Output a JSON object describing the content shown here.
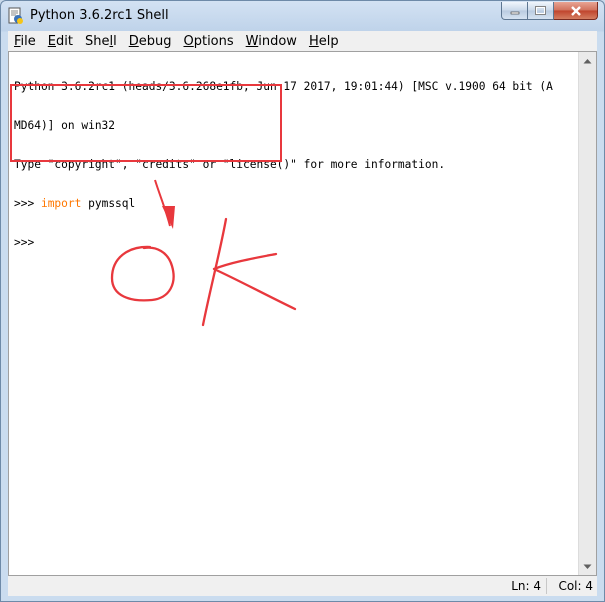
{
  "window": {
    "title": "Python 3.6.2rc1 Shell"
  },
  "menu": [
    {
      "pre": "",
      "u": "F",
      "post": "ile"
    },
    {
      "pre": "",
      "u": "E",
      "post": "dit"
    },
    {
      "pre": "She",
      "u": "l",
      "post": "l"
    },
    {
      "pre": "",
      "u": "D",
      "post": "ebug"
    },
    {
      "pre": "",
      "u": "O",
      "post": "ptions"
    },
    {
      "pre": "",
      "u": "W",
      "post": "indow"
    },
    {
      "pre": "",
      "u": "H",
      "post": "elp"
    }
  ],
  "shell": {
    "line1": "Python 3.6.2rc1 (heads/3.6:268e1fb, Jun 17 2017, 19:01:44) [MSC v.1900 64 bit (A",
    "line2": "MD64)] on win32",
    "line3": "Type \"copyright\", \"credits\" or \"license()\" for more information.",
    "prompt": ">>> ",
    "keyword": "import",
    "module": " pymssql",
    "prompt2": ">>> "
  },
  "status": {
    "ln": "Ln: 4",
    "col": "Col: 4"
  },
  "colors": {
    "keyword": "#ff7700",
    "annotation": "#e8383d"
  }
}
